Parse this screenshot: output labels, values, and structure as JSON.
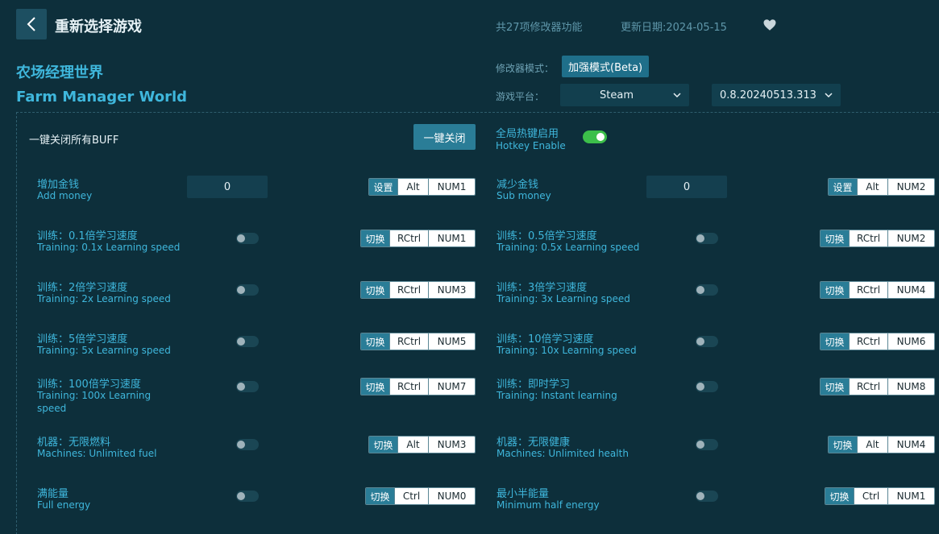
{
  "header": {
    "title": "重新选择游戏",
    "feature_count": "共27项修改器功能",
    "update_date": "更新日期:2024-05-15"
  },
  "game": {
    "name_cn": "农场经理世界",
    "name_en": "Farm Manager World"
  },
  "settings": {
    "mode_label": "修改器模式：",
    "mode_value": "加强模式(Beta)",
    "platform_label": "游戏平台：",
    "platform_value": "Steam",
    "version_value": "0.8.20240513.313"
  },
  "controls": {
    "buff_label": "一键关闭所有BUFF",
    "close_all": "一键关闭",
    "hotkey_cn": "全局热键启用",
    "hotkey_en": "Hotkey Enable",
    "hotkey_enabled": true
  },
  "cheats": [
    {
      "cn": "增加金钱",
      "en": "Add money",
      "type": "input",
      "value": "0",
      "action": "设置",
      "mod": "Alt",
      "key": "NUM1"
    },
    {
      "cn": "减少金钱",
      "en": "Sub money",
      "type": "input",
      "value": "0",
      "action": "设置",
      "mod": "Alt",
      "key": "NUM2"
    },
    {
      "cn": "训练：0.1倍学习速度",
      "en": "Training: 0.1x Learning speed",
      "type": "toggle",
      "action": "切换",
      "mod": "RCtrl",
      "key": "NUM1"
    },
    {
      "cn": "训练：0.5倍学习速度",
      "en": "Training: 0.5x Learning speed",
      "type": "toggle",
      "action": "切换",
      "mod": "RCtrl",
      "key": "NUM2"
    },
    {
      "cn": "训练：2倍学习速度",
      "en": "Training: 2x Learning speed",
      "type": "toggle",
      "action": "切换",
      "mod": "RCtrl",
      "key": "NUM3"
    },
    {
      "cn": "训练：3倍学习速度",
      "en": "Training: 3x Learning speed",
      "type": "toggle",
      "action": "切换",
      "mod": "RCtrl",
      "key": "NUM4"
    },
    {
      "cn": "训练：5倍学习速度",
      "en": "Training: 5x Learning speed",
      "type": "toggle",
      "action": "切换",
      "mod": "RCtrl",
      "key": "NUM5"
    },
    {
      "cn": "训练：10倍学习速度",
      "en": "Training: 10x Learning speed",
      "type": "toggle",
      "action": "切换",
      "mod": "RCtrl",
      "key": "NUM6"
    },
    {
      "cn": "训练：100倍学习速度",
      "en": "Training: 100x Learning",
      "en2": "speed",
      "type": "toggle",
      "action": "切换",
      "mod": "RCtrl",
      "key": "NUM7"
    },
    {
      "cn": "训练：即时学习",
      "en": "Training: Instant learning",
      "type": "toggle",
      "action": "切换",
      "mod": "RCtrl",
      "key": "NUM8"
    },
    {
      "cn": "机器：无限燃料",
      "en": "Machines: Unlimited fuel",
      "type": "toggle",
      "action": "切换",
      "mod": "Alt",
      "key": "NUM3"
    },
    {
      "cn": "机器：无限健康",
      "en": "Machines: Unlimited health",
      "type": "toggle",
      "action": "切换",
      "mod": "Alt",
      "key": "NUM4"
    },
    {
      "cn": "满能量",
      "en": "Full energy",
      "type": "toggle",
      "action": "切换",
      "mod": "Ctrl",
      "key": "NUM0"
    },
    {
      "cn": "最小半能量",
      "en": "Minimum half energy",
      "type": "toggle",
      "action": "切换",
      "mod": "Ctrl",
      "key": "NUM1"
    }
  ],
  "colors": {
    "background": "#0d2f3b",
    "accent": "#3fb7dc",
    "button": "#2a7d97",
    "toggle_on": "#3cbf4a"
  }
}
